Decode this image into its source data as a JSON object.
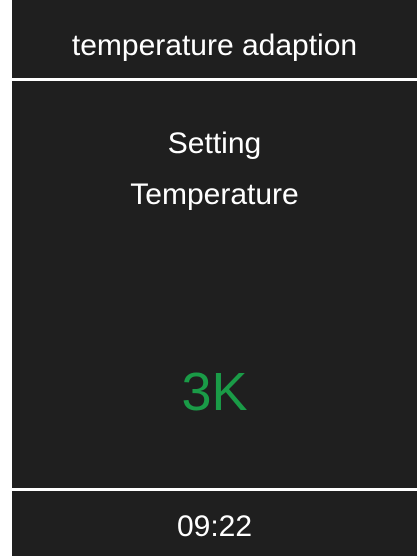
{
  "header": {
    "title": "temperature adaption"
  },
  "main": {
    "label_line1": "Setting",
    "label_line2": "Temperature",
    "value": "3K"
  },
  "footer": {
    "time": "09:22"
  },
  "colors": {
    "background": "#1f1f1f",
    "text": "#ffffff",
    "value_accent": "#1a9b47"
  }
}
